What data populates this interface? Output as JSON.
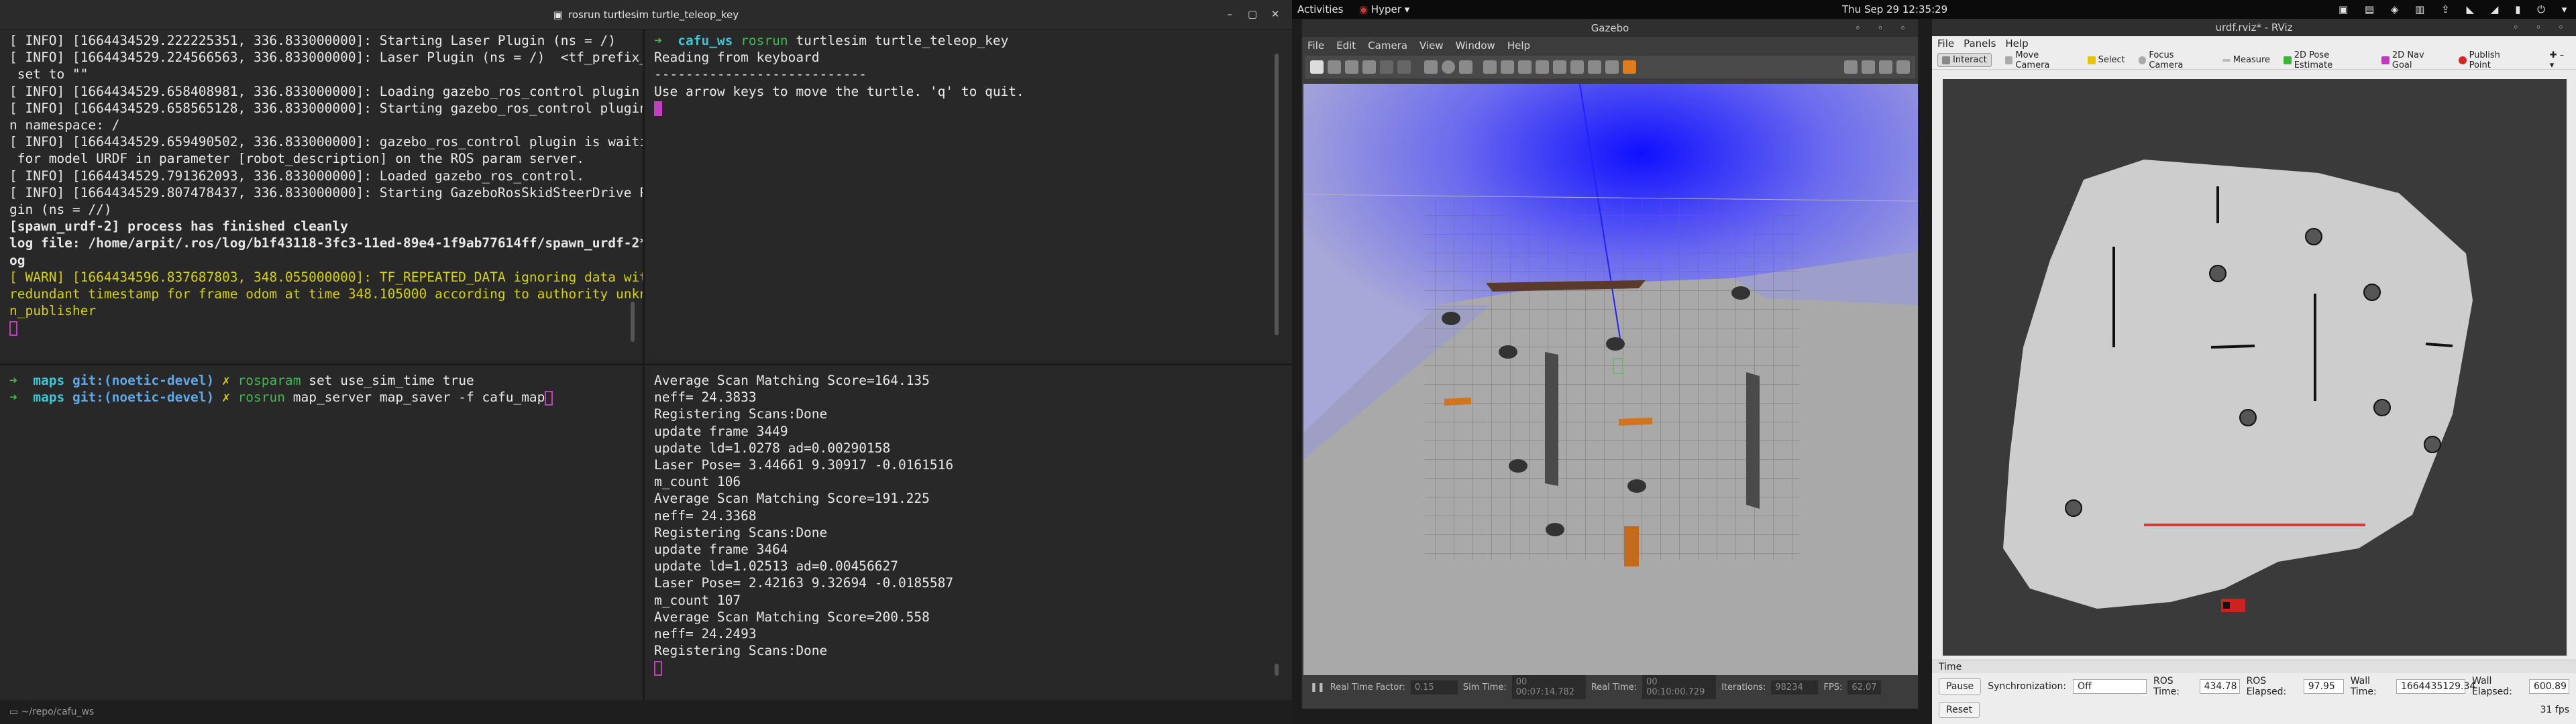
{
  "topbar": {
    "activities": "Activities",
    "app": "Hyper",
    "clock": "Thu Sep 29  12:35:29"
  },
  "terminal": {
    "title": "rosrun turtlesim turtle_teleop_key",
    "status": "~/repo/cafu_ws",
    "pane_tl": [
      {
        "t": "[ INFO] [1664434529.222225351, 336.833000000]: Starting Laser Plugin (ns = /)",
        "c": ""
      },
      {
        "t": "[ INFO] [1664434529.224566563, 336.833000000]: Laser Plugin (ns = /)  <tf_prefix_>,",
        "c": ""
      },
      {
        "t": " set to \"\"",
        "c": ""
      },
      {
        "t": "[ INFO] [1664434529.658408981, 336.833000000]: Loading gazebo_ros_control plugin",
        "c": ""
      },
      {
        "t": "[ INFO] [1664434529.658565128, 336.833000000]: Starting gazebo_ros_control plugin i",
        "c": ""
      },
      {
        "t": "n namespace: /",
        "c": ""
      },
      {
        "t": "[ INFO] [1664434529.659490502, 336.833000000]: gazebo_ros_control plugin is waiting",
        "c": ""
      },
      {
        "t": " for model URDF in parameter [robot_description] on the ROS param server.",
        "c": ""
      },
      {
        "t": "[ INFO] [1664434529.791362093, 336.833000000]: Loaded gazebo_ros_control.",
        "c": ""
      },
      {
        "t": "[ INFO] [1664434529.807478437, 336.833000000]: Starting GazeboRosSkidSteerDrive Plu",
        "c": ""
      },
      {
        "t": "gin (ns = //)",
        "c": ""
      },
      {
        "t": "[spawn_urdf-2] process has finished cleanly",
        "c": "bold"
      },
      {
        "t": "log file: /home/arpit/.ros/log/b1f43118-3fc3-11ed-89e4-1f9ab77614ff/spawn_urdf-2*.l",
        "c": "bold"
      },
      {
        "t": "og",
        "c": "bold"
      },
      {
        "t": "[ WARN] [1664434596.837687803, 348.055000000]: TF_REPEATED_DATA ignoring data with",
        "c": "warn"
      },
      {
        "t": "redundant timestamp for frame odom at time 348.105000 according to authority unknow",
        "c": "warn"
      },
      {
        "t": "n_publisher",
        "c": "warn"
      }
    ],
    "pane_tr": {
      "prompt_dir": "cafu_ws",
      "cmd_name": "rosrun",
      "cmd_args": "turtlesim turtle_teleop_key",
      "lines": [
        "Reading from keyboard",
        "---------------------------",
        "Use arrow keys to move the turtle. 'q' to quit."
      ]
    },
    "pane_bl": [
      {
        "dir": "maps",
        "git": "git:(noetic-devel)",
        "x": "✗",
        "cmd": "rosparam",
        "args": "set use_sim_time true"
      },
      {
        "dir": "maps",
        "git": "git:(noetic-devel)",
        "x": "✗",
        "cmd": "rosrun",
        "args": "map_server map_saver -f cafu_map"
      }
    ],
    "pane_br": [
      "Average Scan Matching Score=164.135",
      "neff= 24.3833",
      "Registering Scans:Done",
      "update frame 3449",
      "update ld=1.0278 ad=0.00290158",
      "Laser Pose= 3.44661 9.30917 -0.0161516",
      "m_count 106",
      "Average Scan Matching Score=191.225",
      "neff= 24.3368",
      "Registering Scans:Done",
      "update frame 3464",
      "update ld=1.02513 ad=0.00456627",
      "Laser Pose= 2.42163 9.32694 -0.0185587",
      "m_count 107",
      "Average Scan Matching Score=200.558",
      "neff= 24.2493",
      "Registering Scans:Done"
    ]
  },
  "gazebo": {
    "title": "Gazebo",
    "menu": [
      "File",
      "Edit",
      "Camera",
      "View",
      "Window",
      "Help"
    ],
    "status": {
      "rtf_label": "Real Time Factor:",
      "rtf": "0.15",
      "sim_label": "Sim Time:",
      "sim": "00 00:07:14.782",
      "real_label": "Real Time:",
      "real": "00 00:10:00.729",
      "iter_label": "Iterations:",
      "iter": "98234",
      "fps_label": "FPS:",
      "fps": "62.07"
    }
  },
  "rviz": {
    "title": "urdf.rviz* - RViz",
    "menu": [
      "File",
      "Panels",
      "Help"
    ],
    "tools": [
      "Interact",
      "Move Camera",
      "Select",
      "Focus Camera",
      "Measure",
      "2D Pose Estimate",
      "2D Nav Goal",
      "Publish Point"
    ],
    "time_panel": "Time",
    "pause": "Pause",
    "sync_label": "Synchronization:",
    "sync_value": "Off",
    "ros_time_label": "ROS Time:",
    "ros_time": "434.78",
    "ros_elapsed_label": "ROS Elapsed:",
    "ros_elapsed": "97.95",
    "wall_time_label": "Wall Time:",
    "wall_time": "1664435129.34",
    "wall_elapsed_label": "Wall Elapsed:",
    "wall_elapsed": "600.89",
    "reset": "Reset",
    "fps": "31 fps"
  }
}
